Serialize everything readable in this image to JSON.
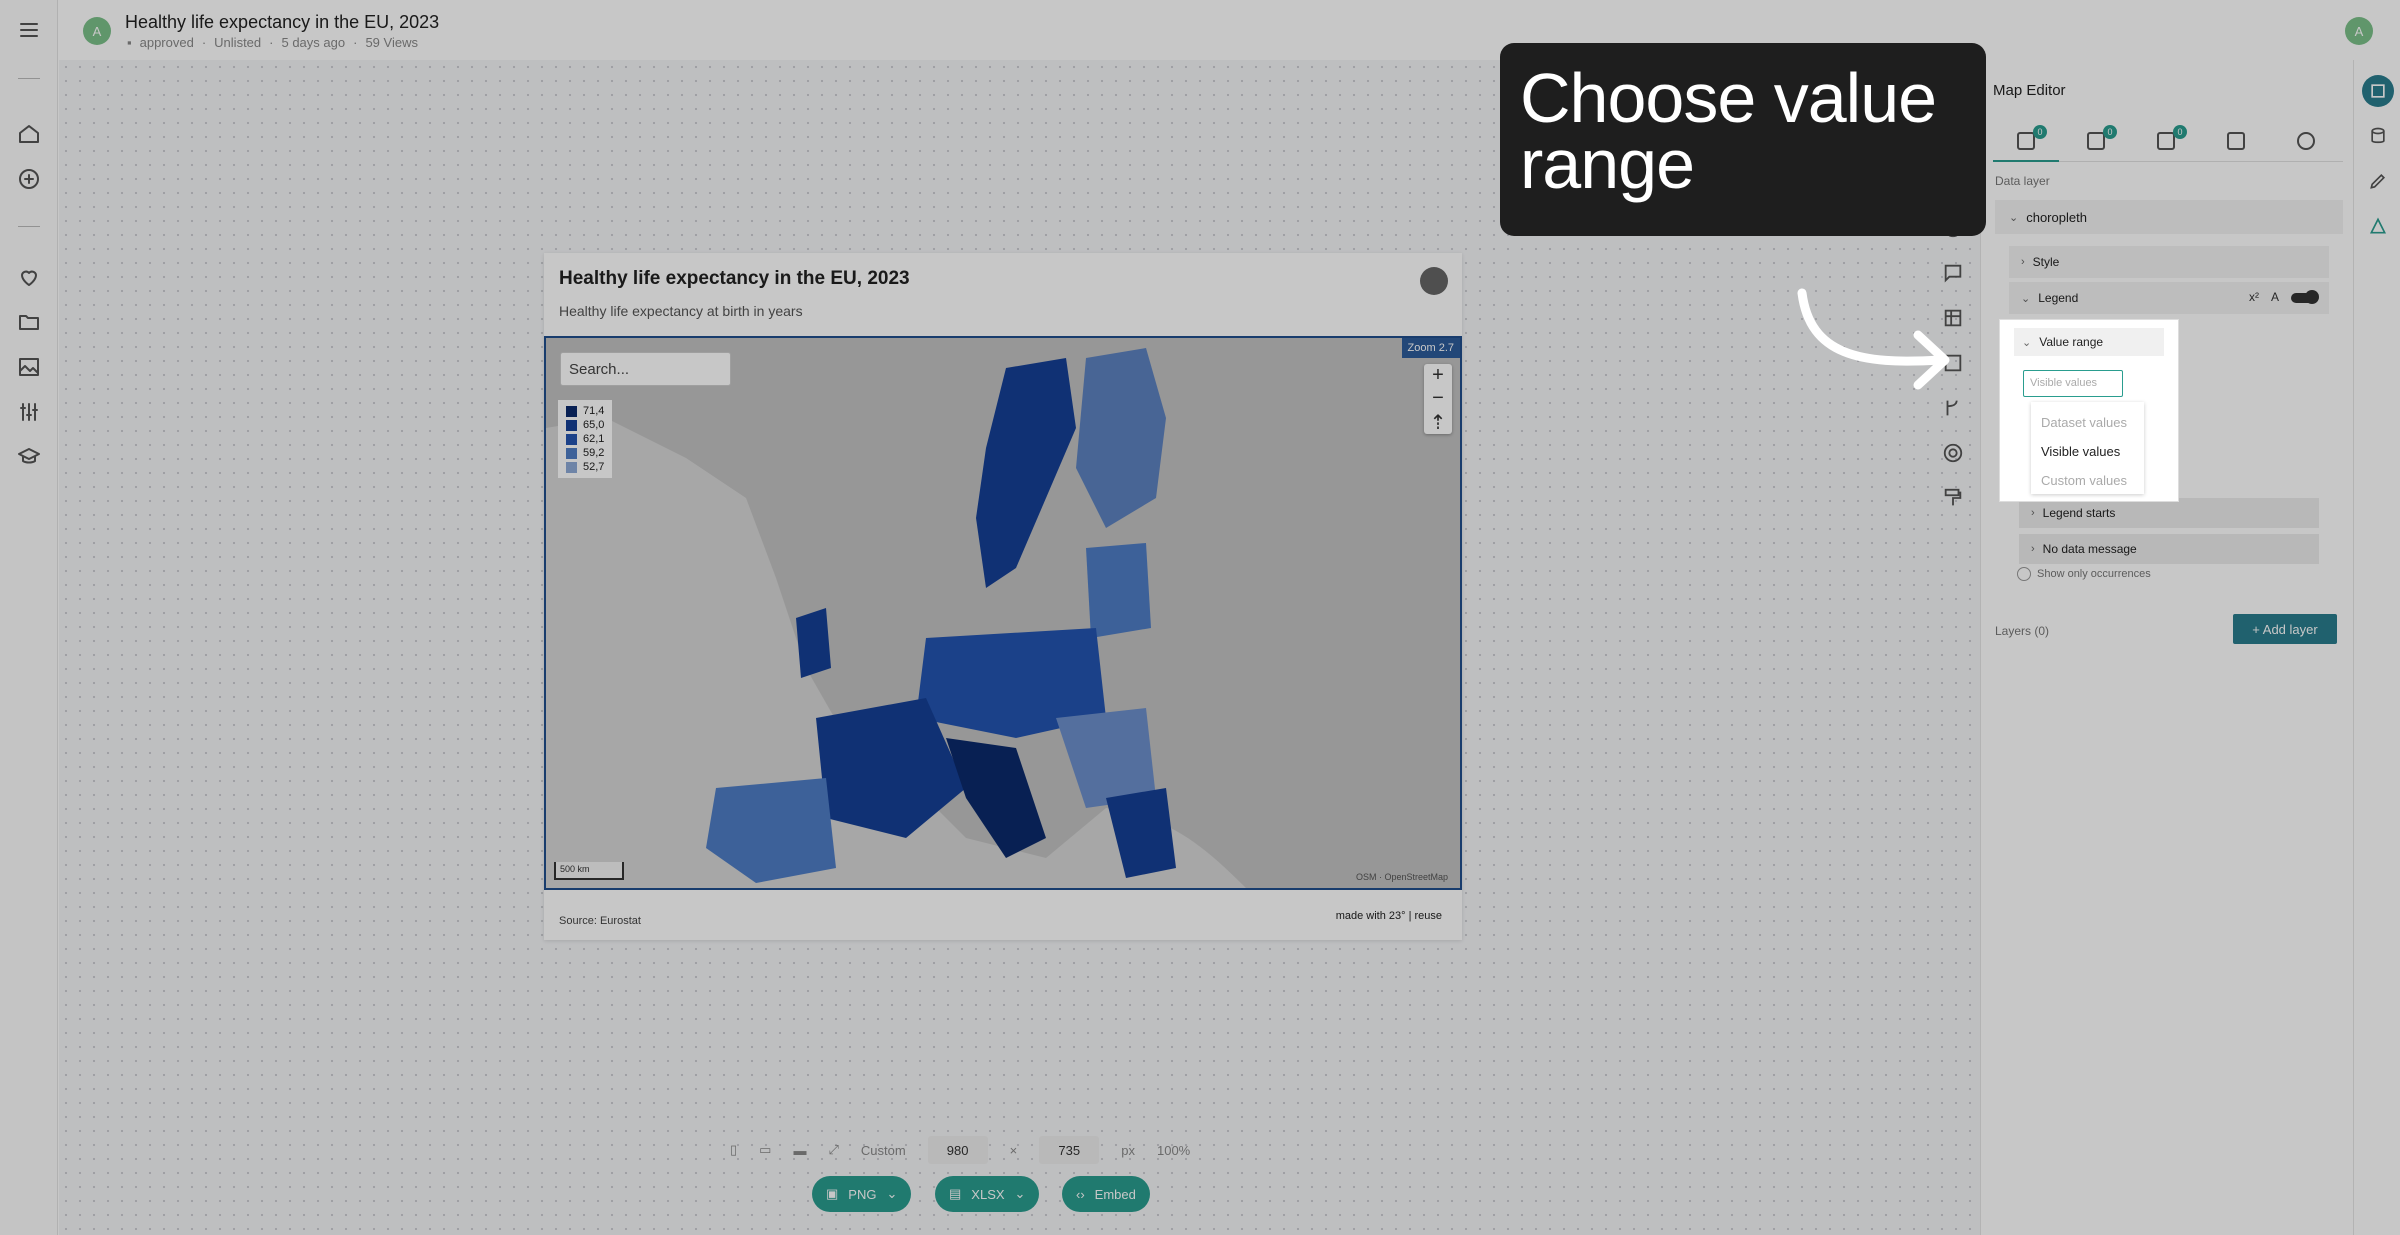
{
  "header": {
    "title": "Healthy life expectancy in the EU, 2023",
    "status": "approved",
    "visibility": "Unlisted",
    "age": "5 days ago",
    "views": "59 Views",
    "avatar_letter": "A",
    "user_avatar_letter": "A"
  },
  "leftnav": {
    "icons": [
      "menu-icon",
      "home-icon",
      "add-icon",
      "heart-icon",
      "folder-icon",
      "image-icon",
      "sliders-icon",
      "graduation-icon"
    ]
  },
  "card": {
    "title": "Healthy life expectancy at birth in years",
    "heading": "Healthy life expectancy in the EU, 2023",
    "search_placeholder": "Search...",
    "legend": [
      {
        "label": "71,4",
        "color": "#0b2a6b"
      },
      {
        "label": "65,0",
        "color": "#153f95"
      },
      {
        "label": "62,1",
        "color": "#2354b0"
      },
      {
        "label": "59,2",
        "color": "#4f7dc4"
      },
      {
        "label": "52,7",
        "color": "#8eaad7"
      }
    ],
    "zoom_label": "Zoom 2.7",
    "scale_label": "500 km",
    "attribution": "OSM · OpenStreetMap",
    "source": "Source: Eurostat",
    "made_with": "made with 23° | reuse",
    "logo_text": "23°"
  },
  "editor": {
    "title": "Map Editor",
    "tab_badges": [
      "0",
      "0",
      "0"
    ],
    "data_layer_label": "Data layer",
    "layer_name": "choropleth",
    "style_label": "Style",
    "legend_label": "Legend",
    "legend_tools": [
      "x²",
      "A"
    ],
    "legend_starts": "Legend starts",
    "no_data_message": "No data message",
    "show_only": "Show only occurrences",
    "layers_label": "Layers (0)",
    "add_layer": "+ Add layer"
  },
  "value_range": {
    "label": "Value range",
    "selected": "Visible values",
    "options": [
      "Dataset values",
      "Visible values",
      "Custom values"
    ]
  },
  "callout": {
    "text": "Choose value range"
  },
  "bottombar": {
    "preset": "Custom",
    "width": "980",
    "height": "735",
    "unit": "px",
    "zoom": "100%",
    "times": "×"
  },
  "export": {
    "png": "PNG",
    "xlsx": "XLSX",
    "embed": "Embed"
  },
  "colors": {
    "accent": "#2a9d8f",
    "map_border": "#1f4e8c"
  }
}
